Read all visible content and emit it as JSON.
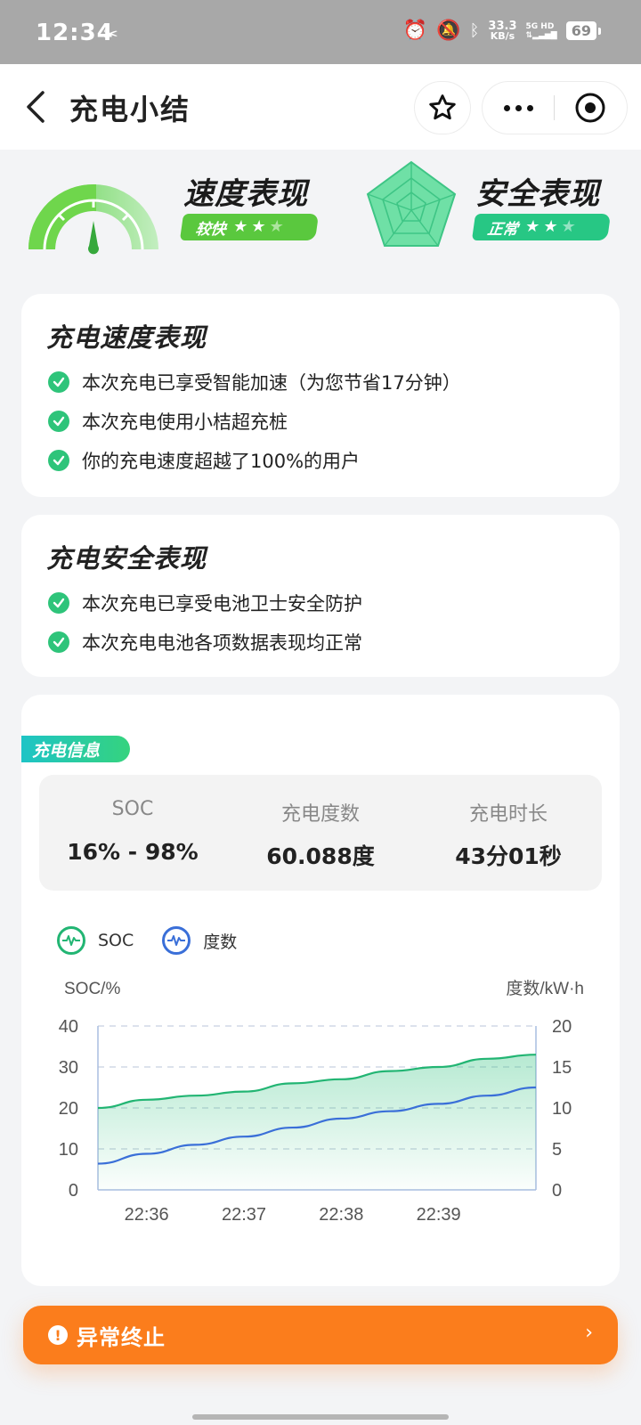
{
  "status_bar": {
    "time": "12:34",
    "speed_value": "33.3",
    "speed_unit": "KB/s",
    "network_top": "5G HD",
    "battery": "69"
  },
  "header": {
    "title": "充电小结"
  },
  "summary": {
    "speed_title": "速度表现",
    "speed_badge": "较快",
    "speed_stars": 2,
    "safety_title": "安全表现",
    "safety_badge": "正常",
    "safety_stars": 2
  },
  "speed_card": {
    "title": "充电速度表现",
    "items": [
      "本次充电已享受智能加速（为您节省17分钟）",
      "本次充电使用小桔超充桩",
      "你的充电速度超越了100%的用户"
    ]
  },
  "safety_card": {
    "title": "充电安全表现",
    "items": [
      "本次充电已享受电池卫士安全防护",
      "本次充电电池各项数据表现均正常"
    ]
  },
  "info_card": {
    "tag": "充电信息",
    "stats": [
      {
        "label": "SOC",
        "value": "16% - 98%"
      },
      {
        "label": "充电度数",
        "value": "60.088度"
      },
      {
        "label": "充电时长",
        "value": "43分01秒"
      }
    ],
    "legend": [
      {
        "label": "SOC",
        "color": "#22b573"
      },
      {
        "label": "度数",
        "color": "#3a6fd8"
      }
    ]
  },
  "chart_data": {
    "type": "line",
    "x": [
      "22:35:30",
      "22:36",
      "22:36:30",
      "22:37",
      "22:37:30",
      "22:38",
      "22:38:30",
      "22:39",
      "22:39:30",
      "22:40"
    ],
    "x_ticks": [
      "22:36",
      "22:37",
      "22:38",
      "22:39"
    ],
    "y_left_label": "SOC/%",
    "y_right_label": "度数/kW·h",
    "y_left_ticks": [
      "0",
      "10",
      "20",
      "30",
      "40"
    ],
    "y_right_ticks": [
      "0",
      "5",
      "10",
      "15",
      "20"
    ],
    "ylim_left": [
      0,
      40
    ],
    "ylim_right": [
      0,
      20
    ],
    "series": [
      {
        "name": "SOC",
        "axis": "left",
        "color": "#22b573",
        "values": [
          20,
          22,
          23,
          24,
          26,
          27,
          29,
          30,
          32,
          33
        ]
      },
      {
        "name": "度数",
        "axis": "right",
        "color": "#3a6fd8",
        "values": [
          3.2,
          4.4,
          5.5,
          6.5,
          7.6,
          8.7,
          9.6,
          10.5,
          11.5,
          12.5
        ]
      }
    ]
  },
  "abnormal": {
    "label": "异常终止",
    "icon_text": "!",
    "chevron": "›"
  }
}
